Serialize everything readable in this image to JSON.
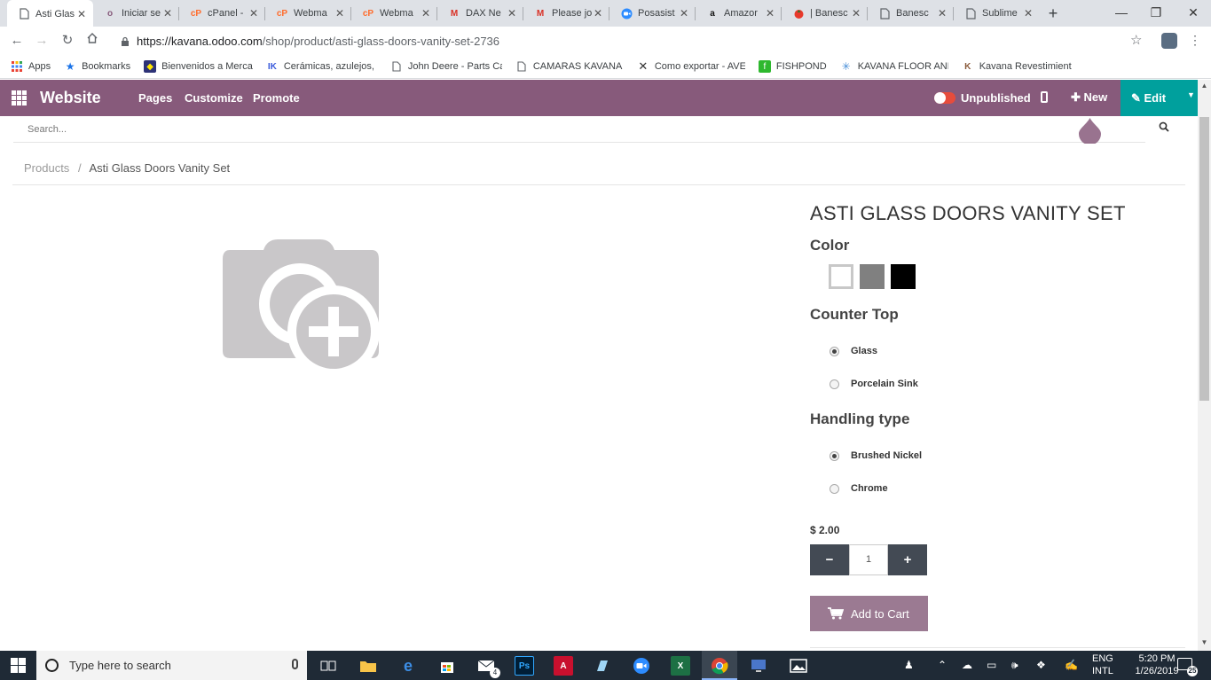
{
  "browser": {
    "tabs": [
      {
        "label": "Asti Glas",
        "icon": "document-icon",
        "active": true
      },
      {
        "label": "Iniciar se",
        "icon": "odoo-icon"
      },
      {
        "label": "cPanel -",
        "icon": "cpanel-icon"
      },
      {
        "label": "Webma",
        "icon": "cpanel-icon"
      },
      {
        "label": "Webma",
        "icon": "cpanel-icon"
      },
      {
        "label": "DAX Ne",
        "icon": "gmail-icon"
      },
      {
        "label": "Please jo",
        "icon": "gmail-icon"
      },
      {
        "label": "Posasist",
        "icon": "zoom-icon"
      },
      {
        "label": "Amazor",
        "icon": "amazon-icon"
      },
      {
        "label": "| Banesc",
        "icon": "banesco-icon"
      },
      {
        "label": "Banesc",
        "icon": "document-icon"
      },
      {
        "label": "Sublime",
        "icon": "document-icon"
      }
    ],
    "url_host": "https://kavana.odoo.com",
    "url_path": "/shop/product/asti-glass-doors-vanity-set-2736",
    "bookmarks": [
      {
        "label": "Apps",
        "icon": "apps-grid-icon"
      },
      {
        "label": "Bookmarks",
        "icon": "star-icon"
      },
      {
        "label": "Bienvenidos a Merca",
        "icon": "mercado-icon"
      },
      {
        "label": "Cerámicas, azulejos, l",
        "icon": "ceramica-icon"
      },
      {
        "label": "John Deere - Parts Ca",
        "icon": "document-icon"
      },
      {
        "label": "CAMARAS KAVANA F",
        "icon": "document-icon"
      },
      {
        "label": "Como exportar - AVE",
        "icon": "x-logo-icon"
      },
      {
        "label": "FISHPOND",
        "icon": "fishpond-icon"
      },
      {
        "label": "KAVANA FLOOR AND",
        "icon": "kavana-icon"
      },
      {
        "label": "Kavana Revestimient",
        "icon": "kavana-revest-icon"
      }
    ]
  },
  "odoo_nav": {
    "brand": "Website",
    "links": [
      "Pages",
      "Customize",
      "Promote"
    ],
    "status": "Unpublished",
    "new_label": "New",
    "edit_label": "Edit"
  },
  "page": {
    "search_placeholder": "Search...",
    "breadcrumb_parent": "Products",
    "breadcrumb_separator": "/",
    "breadcrumb_current": "Asti Glass Doors Vanity Set",
    "product_title": "ASTI GLASS DOORS VANITY SET",
    "color_label": "Color",
    "colors": [
      "#ffffff",
      "#808080",
      "#000000"
    ],
    "countertop_label": "Counter Top",
    "countertop_options": [
      {
        "label": "Glass",
        "selected": true
      },
      {
        "label": "Porcelain Sink",
        "selected": false
      }
    ],
    "handling_label": "Handling type",
    "handling_options": [
      {
        "label": "Brushed Nickel",
        "selected": true
      },
      {
        "label": "Chrome",
        "selected": false
      }
    ],
    "price": "$ 2.00",
    "quantity": "1",
    "add_to_cart": "Add to Cart",
    "accent_color": "#875a7b",
    "edit_color": "#00a09d"
  },
  "taskbar": {
    "search_placeholder": "Type here to search",
    "lang_line1": "ENG",
    "lang_line2": "INTL",
    "time": "5:20 PM",
    "date": "1/26/2019",
    "notification_count": "25",
    "mail_badge": "4"
  }
}
